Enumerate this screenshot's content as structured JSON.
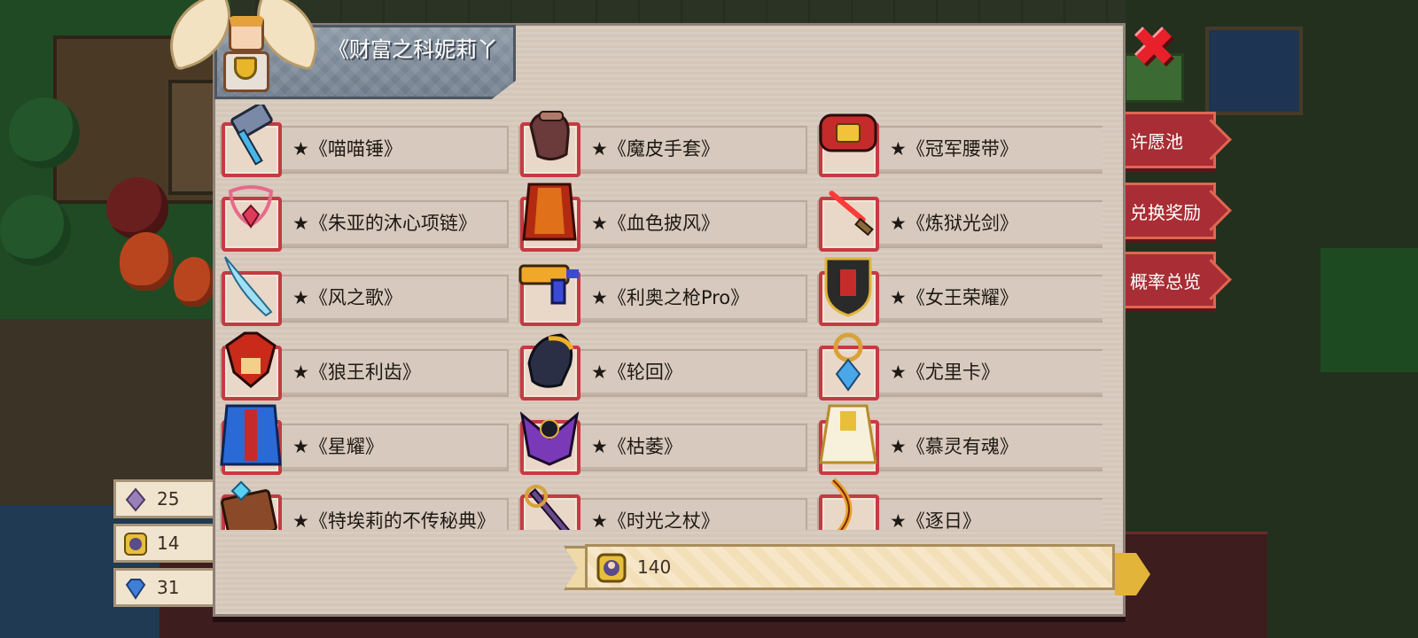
{
  "panel": {
    "title": "《财富之科妮莉丫"
  },
  "side_menu": [
    {
      "label": "许愿池"
    },
    {
      "label": "兑换奖励"
    },
    {
      "label": "概率总览"
    }
  ],
  "currencies": [
    {
      "icon": "crystal-icon",
      "value": "25"
    },
    {
      "icon": "coin-icon",
      "value": "14"
    },
    {
      "icon": "gem-icon",
      "value": "31"
    }
  ],
  "items": [
    {
      "label": "★《喵喵锤》",
      "icon": "hammer-icon"
    },
    {
      "label": "★《魔皮手套》",
      "icon": "glove-icon"
    },
    {
      "label": "★《冠军腰带》",
      "icon": "belt-icon"
    },
    {
      "label": "★《朱亚的沐心项链》",
      "icon": "necklace-icon"
    },
    {
      "label": "★《血色披风》",
      "icon": "cape-icon"
    },
    {
      "label": "★《炼狱光剑》",
      "icon": "lightsaber-icon"
    },
    {
      "label": "★《风之歌》",
      "icon": "blade-icon"
    },
    {
      "label": "★《利奥之枪Pro》",
      "icon": "gun-icon"
    },
    {
      "label": "★《女王荣耀》",
      "icon": "shield-icon"
    },
    {
      "label": "★《狼王利齿》",
      "icon": "wolf-fang-icon"
    },
    {
      "label": "★《轮回》",
      "icon": "claw-icon"
    },
    {
      "label": "★《尤里卡》",
      "icon": "amulet-icon"
    },
    {
      "label": "★《星耀》",
      "icon": "blue-cape-icon"
    },
    {
      "label": "★《枯萎》",
      "icon": "dark-wings-icon"
    },
    {
      "label": "★《慕灵有魂》",
      "icon": "robe-icon"
    },
    {
      "label": "★《特埃莉的不传秘典》",
      "icon": "book-icon"
    },
    {
      "label": "★《时光之杖》",
      "icon": "staff-icon"
    },
    {
      "label": "★《逐日》",
      "icon": "bow-icon"
    }
  ],
  "cost": {
    "value": "140",
    "icon": "coin-icon"
  },
  "colors": {
    "frame": "#c63a42",
    "panel_bg": "#d9ccc0",
    "side_button": "#a92d34",
    "close": "#e8202a"
  }
}
